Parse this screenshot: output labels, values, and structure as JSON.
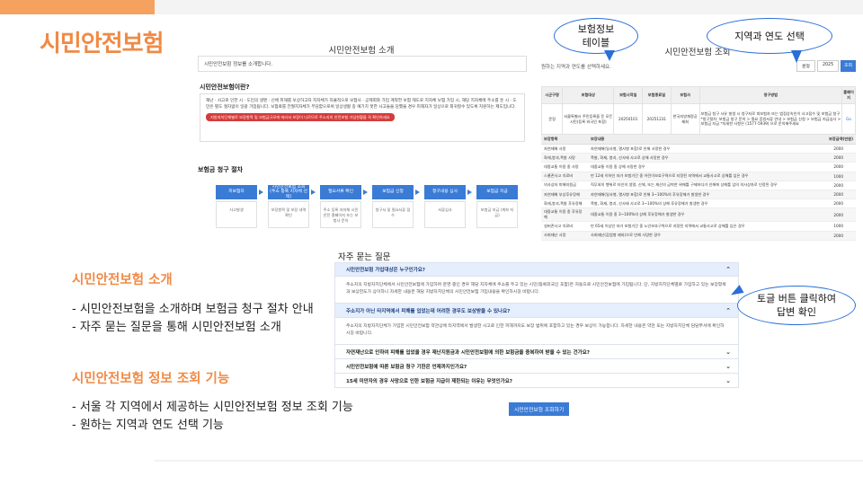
{
  "header": {
    "title": "시민안전보험"
  },
  "left_text": {
    "section1_title": "시민안전보험 소개",
    "section1_bullets": [
      "- 시민안전보험을 소개하며 보험금 청구 절차 안내",
      "- 자주 묻는 질문을 통해 시민안전보험 소개"
    ],
    "section2_title": "시민안전보험 정보 조회 기능",
    "section2_bullets": [
      "- 서울 각 지역에서 제공하는 시민안전보험 정보 조회 기능",
      "- 원하는 지역과 연도 선택 기능"
    ]
  },
  "intro_panel": {
    "title": "시민안전보험 소개",
    "intro_text": "시민안전보험 정보를 소개합니다.",
    "what_heading": "시민안전보험이란?",
    "what_body": "재난 · 사고로 인한 시 · 도민의 생명 · 신체 피해를 보상하고자 지자체가 자율적으로 보험사 · 공제회와 가입 계약한 보험 제도로 지자체 보험 가입 시, 해당 지자체에 주소를 둔 시 · 도민은 별도 절차없이 일괄 가입됩니다. 보험료를 전월지자체가 부담함으로써 일상생활 중 예기치 못한 사고들을 당했을 경우 피해자가 일상으로 회귀할수 있도록 지원하는 제도입니다.",
    "warning": "지방자치단체별로 보장항목 및 보험금규모에 따라서 보장이 다르므로 주소지의 안전보험 가입현황을 꼭 확인하세요",
    "process_heading": "보험금 청구 절차",
    "steps": [
      {
        "label": "피보험자",
        "desc": "사고발생"
      },
      {
        "label": "시민안전보험 조회 (주소 등록 지자체 선택)",
        "desc": "보장항목 및 보장 내역 확인"
      },
      {
        "label": "필요서류 확인",
        "desc": "주소 등록 지자체 시민안전 홈페이지 또는 보험사 문의"
      },
      {
        "label": "보험금 신청",
        "desc": "청구서 및 필요서류 접수"
      },
      {
        "label": "청구내용 심사",
        "desc": "서류심사"
      },
      {
        "label": "보험금 지급",
        "desc": "보험금 지급 (계좌 지급)"
      }
    ]
  },
  "lookup_panel": {
    "title": "시민안전보험 조회",
    "prompt": "원하는 지역과 연도를 선택하세요.",
    "region_select": "문정",
    "year_select": "2025",
    "search_button": "조회",
    "summary_headers": [
      "시군구명",
      "보험대상",
      "보험시작일",
      "보험종료일",
      "보험사",
      "청구방법",
      "홈페이지"
    ],
    "summary_row": [
      "문정",
      "서울특별시 주민등록을 둔 모든 시민(등록 외국인 포함)",
      "20250101",
      "20251231",
      "한국지방재정공제회",
      "보험금 청구 사유 발생 시 청구자로 피보험자 또는 법정상속인이 사고접수 및 보험금 청구 *청구절차: 보험금 청구 문의 > 필요 증빙서류 안내 > 보험금 신청 > 보험금 지급심사 > 보험금 지급 *지세한 사항은 (1577-5939) 으로 문의해주세요",
      "Go"
    ],
    "coverage_headers": [
      "보장항목",
      "보장내용",
      "보장금액(만원)"
    ],
    "coverage_rows": [
      [
        "자연재해 사망",
        "자연재해(일사병, 열사병 포함)로 인해 사망한 경우",
        "2000"
      ],
      [
        "화재,붕괴,폭발 사망",
        "폭발, 화재, 붕괴, 산사태 사고로 상해 사망한 경우",
        "2000"
      ],
      [
        "대중교통 이용 중 사망",
        "대중교통 이용 중 상해 사망한 경우",
        "2000"
      ],
      [
        "스쿨존사고 치료비",
        "만 12세 이하인 자가 보험기간 중 어린이보호구역으로 지정된 지역에서 교통사고로 상해를 입은 경우",
        "1000"
      ],
      [
        "의사상자 피해지원금",
        "직무외의 행위로 타인의 생명, 신체, 또는 재산의 급박한 위해를 구제하다가 인해에 상해를 입의 의사상자로 인정된 경우",
        "2000"
      ],
      [
        "자연재해 부상후유장해",
        "자연재해(일사병, 열사병 포함)로 인해 3~100%의 후유장해가 발생한 경우",
        "2000"
      ],
      [
        "화재,붕괴,폭발 후유장해",
        "폭발, 화재, 붕괴, 산사태 사고로 3~100%의 상해 후유장해가 발생한 경우",
        "2000"
      ],
      [
        "대중교통 이용 중 후유장해",
        "대중교통 이용 중 3~100%의 상해 후유장해가 발생한 경우",
        "2000"
      ],
      [
        "실버존사고 치료비",
        "만 65세 이상인 자가 보험기간 중 노인보호구역으로 지정된 지역에서 교통사고로 상해를 입은 경우",
        "1000"
      ],
      [
        "사회재난 사망",
        "사회재난(감염병 제외)으로 인해 사망한 경우",
        "2000"
      ]
    ]
  },
  "faq_panel": {
    "heading": "자주 묻는 질문",
    "items": [
      {
        "q": "시민안전보험 가입대상은 누구인가요?",
        "a": "주소지의 지방자치단체에서 시민안전보험에 가입하여 운영 중인 경우 해당 지자체에 주소를 두고 있는 시민(등록외국인 포함)은 자동으로 시민안전보험에 가입됩니다. 단, 지방자치단체별로 가입하고 있는 보장항목과 보상한도가 상이하니 자세한 내용은 해당 지방자치단체의 시민안전보험 가입내용을 확인하시길 바랍니다.",
        "open": true
      },
      {
        "q": "주소지가 아닌 타지역에서 피해를 입었는데 어려한 경우도 보상받을 수 있나요?",
        "a": "주소지의 지방자치단체가 가입한 시민안전보험 약관상에 타지역에서 발생한 사고로 인한 피해까지도 보장 범위에 포함하고 있는 경우 보상이 가능합니다. 자세한 내용은 약관 또는 지방자치단체 담당부서에 확인하시길 바랍니다.",
        "open": true
      },
      {
        "q": "자연재난으로 인하여 피해를 입었을 경우 재난지원금과 시민안전보험에 의한 보험금을 중복하여 받을 수 있는 건가요?",
        "a": "",
        "open": false
      },
      {
        "q": "시민안전보험에 따른 보험금 청구 기한은 언제까지인가요?",
        "a": "",
        "open": false
      },
      {
        "q": "15세 미만자의 경우 사망으로 인한 보험금 지급이 제한되는 이유는 무엇인가요?",
        "a": "",
        "open": false
      }
    ],
    "lookup_button": "시민안전보험 조회하기"
  },
  "callouts": {
    "info_table": "보험정보\n테이블",
    "region_year": "지역과 연도 선택",
    "toggle": "토글 버튼 클릭하여\n답변 확인"
  }
}
